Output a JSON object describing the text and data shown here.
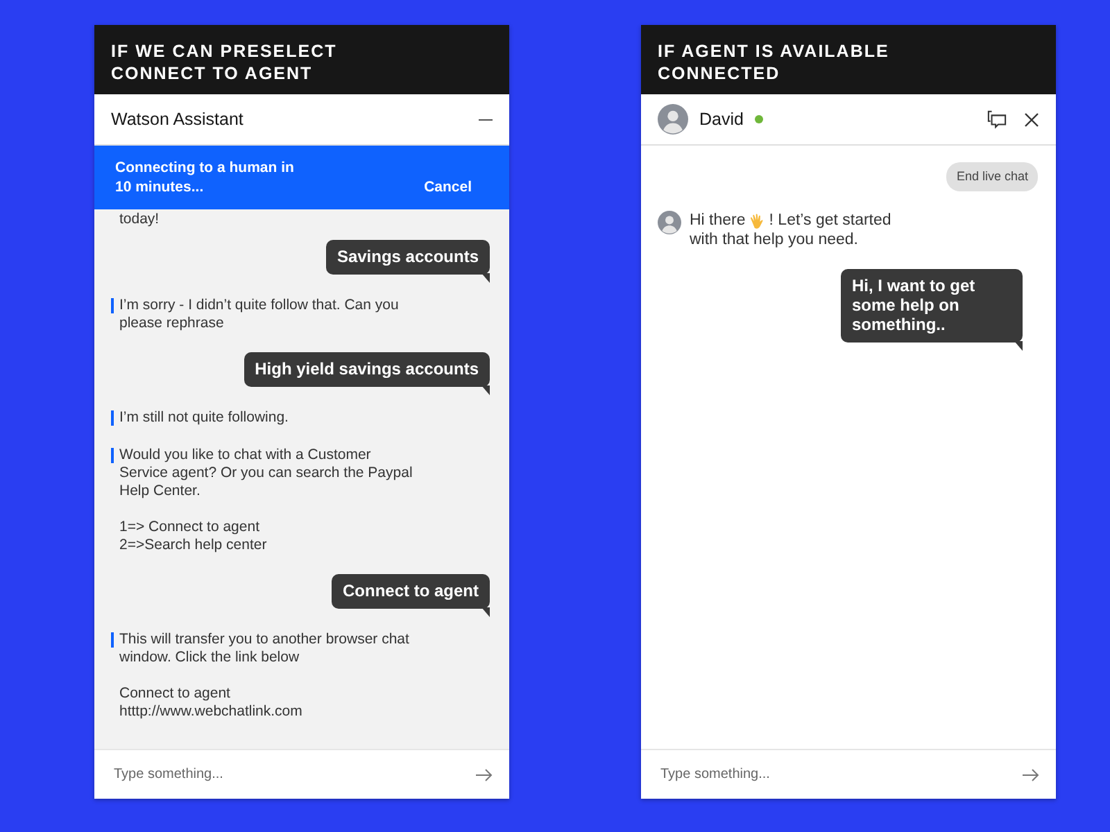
{
  "panels": [
    {
      "kind": "bot",
      "heading": "IF WE CAN  PRESELECT\nCONNECT TO AGENT",
      "title": "Watson Assistant",
      "banner": {
        "text": "Connecting to a human in\n10 minutes...",
        "action": "Cancel"
      },
      "messages": [
        {
          "kind": "continued",
          "text": "today!"
        },
        {
          "kind": "user",
          "text": "Savings accounts"
        },
        {
          "kind": "bot",
          "text": "I’m sorry - I didn’t quite follow that. Can you please rephrase"
        },
        {
          "kind": "user",
          "text": "High yield savings accounts"
        },
        {
          "kind": "bot",
          "text": "I’m still not quite following."
        },
        {
          "kind": "bot",
          "text": "Would you like to chat with a Customer Service agent? Or you can search the Paypal Help Center.\n\n1=> Connect to agent\n2=>Search help center"
        },
        {
          "kind": "user",
          "text": "Connect to agent"
        },
        {
          "kind": "bot",
          "text": "This will transfer you to another browser chat window. Click the link below\n\nConnect to agent\nhtttp://www.webchatlink.com"
        }
      ],
      "input": {
        "placeholder": "Type something..."
      }
    },
    {
      "kind": "agent",
      "heading": "IF AGENT IS AVAILABLE\nCONNECTED",
      "title": "David",
      "online": true,
      "end_chat": "End live chat",
      "messages": [
        {
          "kind": "agent",
          "parts": [
            "Hi there",
            "! Let’s get started",
            "with that help you need."
          ]
        },
        {
          "kind": "user",
          "text": "Hi, I want to get some help on something.."
        }
      ],
      "input": {
        "placeholder": "Type something..."
      }
    }
  ]
}
